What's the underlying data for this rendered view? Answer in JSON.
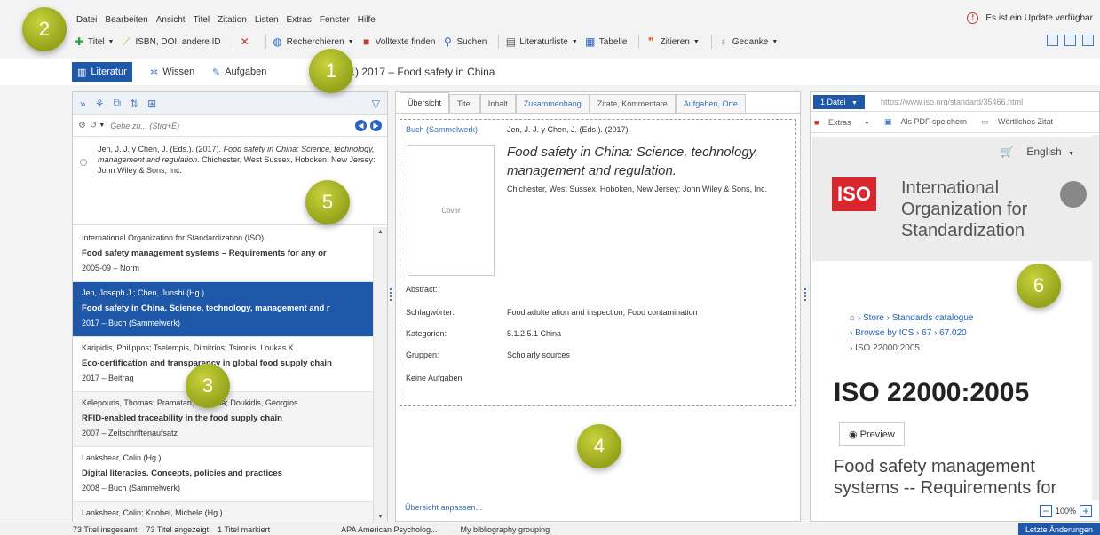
{
  "menu": [
    "Datei",
    "Bearbeiten",
    "Ansicht",
    "Titel",
    "Zitation",
    "Listen",
    "Extras",
    "Fenster",
    "Hilfe"
  ],
  "update": {
    "text": "Es ist ein Update verfügbar"
  },
  "toolbar": {
    "titel": "Titel",
    "isbn": "ISBN, DOI, andere ID",
    "recherchieren": "Recherchieren",
    "volltexte": "Volltexte finden",
    "suchen": "Suchen",
    "literaturliste": "Literaturliste",
    "tabelle": "Tabelle",
    "zitieren": "Zitieren",
    "gedanke": "Gedanke"
  },
  "maintabs": {
    "literatur": "Literatur",
    "wissen": "Wissen",
    "aufgaben": "Aufgaben"
  },
  "doc_title": "n (Ed.) 2017 – Food safety in China",
  "badges": [
    "1",
    "2",
    "3",
    "4",
    "5",
    "6"
  ],
  "search": {
    "placeholder": "Gehe zu... (Strg+E)"
  },
  "citation": {
    "lead": "Jen, J. J. y Chen, J. (Eds.). (2017). ",
    "title": "Food safety in China: Science, technology, management and regulation",
    "rest": ". Chichester, West Sussex, Hoboken, New Jersey: John Wiley & Sons, Inc."
  },
  "list": [
    {
      "authors": "International Organization for Standardization (ISO)",
      "title": "Food safety management systems – Requirements for any or",
      "meta": "2005-09 – Norm"
    },
    {
      "authors": "Jen, Joseph J.; Chen, Junshi (Hg.)",
      "title": "Food safety in China. Science, technology, management and r",
      "meta": "2017 – Buch (Sammelwerk)"
    },
    {
      "authors": "Karipidis, Philippos; Tselempis, Dimitrios; Tsironis, Loukas K.",
      "title": "Eco-certification and transparency in global food supply chain",
      "meta": "2017 – Beitrag"
    },
    {
      "authors": "Kelepouris, Thomas; Pramatari, Katerina; Doukidis, Georgios",
      "title": "RFID-enabled traceability in the food supply chain",
      "meta": "2007 – Zeitschriftenaufsatz"
    },
    {
      "authors": "Lankshear, Colin (Hg.)",
      "title": "Digital literacies. Concepts, policies and practices",
      "meta": "2008 – Buch (Sammelwerk)"
    },
    {
      "authors": "Lankshear, Colin; Knobel, Michele (Hg.)",
      "title": "",
      "meta": ""
    }
  ],
  "midtabs": [
    "Übersicht",
    "Titel",
    "Inhalt",
    "Zusammenhang",
    "Zitate, Kommentare",
    "Aufgaben, Orte"
  ],
  "overview": {
    "type": "Buch (Sammelwerk)",
    "authors": "Jen, J. J. y Chen, J. (Eds.). (2017).",
    "cover": "Cover",
    "title": "Food safety in China: Science, technology, management and regulation.",
    "publisher": "Chichester, West Sussex, Hoboken, New Jersey: John Wiley & Sons, Inc.",
    "abstract_label": "Abstract:",
    "keywords_label": "Schlagwörter:",
    "keywords": "Food adulteration and inspection; Food contamination",
    "categories_label": "Kategorien:",
    "categories": "5.1.2.5.1 China",
    "groups_label": "Gruppen:",
    "groups": "Scholarly sources",
    "tasks": "Keine Aufgaben",
    "customize": "Übersicht anpassen..."
  },
  "right": {
    "file": "1 Datei",
    "url": "https://www.iso.org/standard/35466.html",
    "extras": "Extras",
    "pdf": "Als PDF speichern",
    "quote": "Wörtliches Zitat",
    "lang": "English",
    "iso_logo": "ISO",
    "iso_name": "International Organization for Standardization",
    "crumb1": "Store",
    "crumb2": "Standards catalogue",
    "crumb3": "Browse by ICS",
    "crumb4": "67",
    "crumb5": "67.020",
    "crumb6": "ISO 22000:2005",
    "iso_number": "ISO 22000:2005",
    "preview": "Preview",
    "desc": "Food safety management systems -- Requirements for",
    "zoom": "100%"
  },
  "status": {
    "total": "73 Titel insgesamt",
    "shown": "73 Titel angezeigt",
    "marked": "1 Titel markiert",
    "style": "APA American Psycholog...",
    "grouping": "My bibliography grouping",
    "last": "Letzte Änderungen"
  }
}
